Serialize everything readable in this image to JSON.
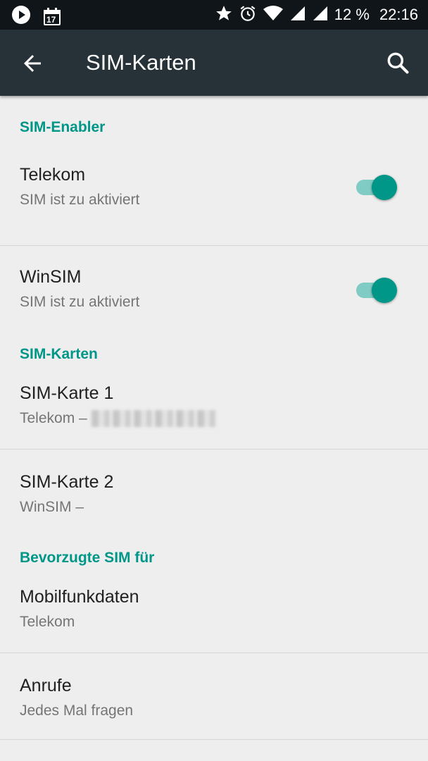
{
  "status_bar": {
    "battery": "12 %",
    "time": "22:16",
    "calendar_day": "17"
  },
  "toolbar": {
    "title": "SIM-Karten"
  },
  "sections": {
    "sim_enabler": {
      "header": "SIM-Enabler",
      "items": [
        {
          "title": "Telekom",
          "subtitle": "SIM ist zu aktiviert",
          "enabled": true
        },
        {
          "title": "WinSIM",
          "subtitle": "SIM ist zu aktiviert",
          "enabled": true
        }
      ]
    },
    "sim_cards": {
      "header": "SIM-Karten",
      "items": [
        {
          "title": "SIM-Karte 1",
          "subtitle": "Telekom –"
        },
        {
          "title": "SIM-Karte 2",
          "subtitle": "WinSIM –"
        }
      ]
    },
    "preferred": {
      "header": "Bevorzugte SIM für",
      "items": [
        {
          "title": "Mobilfunkdaten",
          "subtitle": "Telekom"
        },
        {
          "title": "Anrufe",
          "subtitle": "Jedes Mal fragen"
        }
      ]
    }
  },
  "colors": {
    "accent": "#009688",
    "toolbar": "#263238",
    "status_bar": "#0f1519",
    "background": "#eeeeee"
  }
}
